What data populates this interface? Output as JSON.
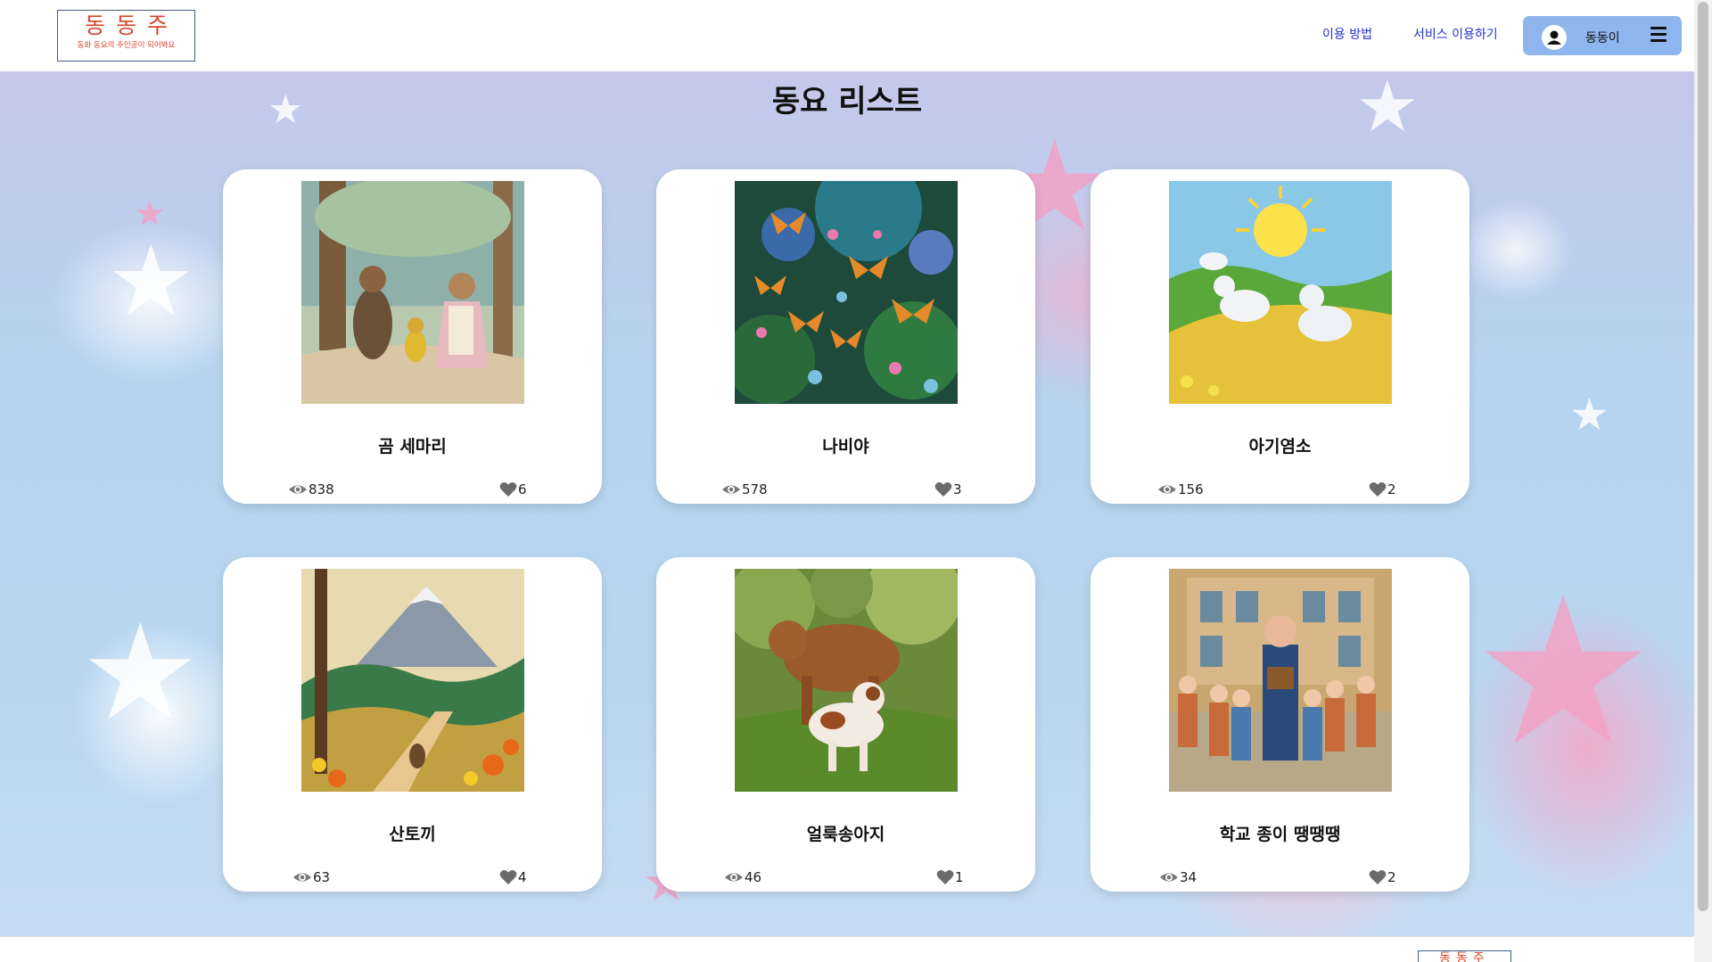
{
  "header": {
    "logo_title": "동동주",
    "logo_subtitle": "동화 동요의 주인공이 되어봐요",
    "nav_guide": "이용 방법",
    "nav_service": "서비스 이용하기",
    "user_name": "동동이"
  },
  "page_title": "동요 리스트",
  "songs": [
    {
      "title": "곰 세마리",
      "views": "838",
      "likes": "6"
    },
    {
      "title": "나비야",
      "views": "578",
      "likes": "3"
    },
    {
      "title": "아기염소",
      "views": "156",
      "likes": "2"
    },
    {
      "title": "산토끼",
      "views": "63",
      "likes": "4"
    },
    {
      "title": "얼룩송아지",
      "views": "46",
      "likes": "1"
    },
    {
      "title": "학교 종이 땡땡땡",
      "views": "34",
      "likes": "2"
    }
  ],
  "footer": {
    "logo_title": "동동주"
  },
  "colors": {
    "nav_link": "#2433c9",
    "user_button": "#8eb5ee",
    "logo_red": "#d8462e"
  }
}
